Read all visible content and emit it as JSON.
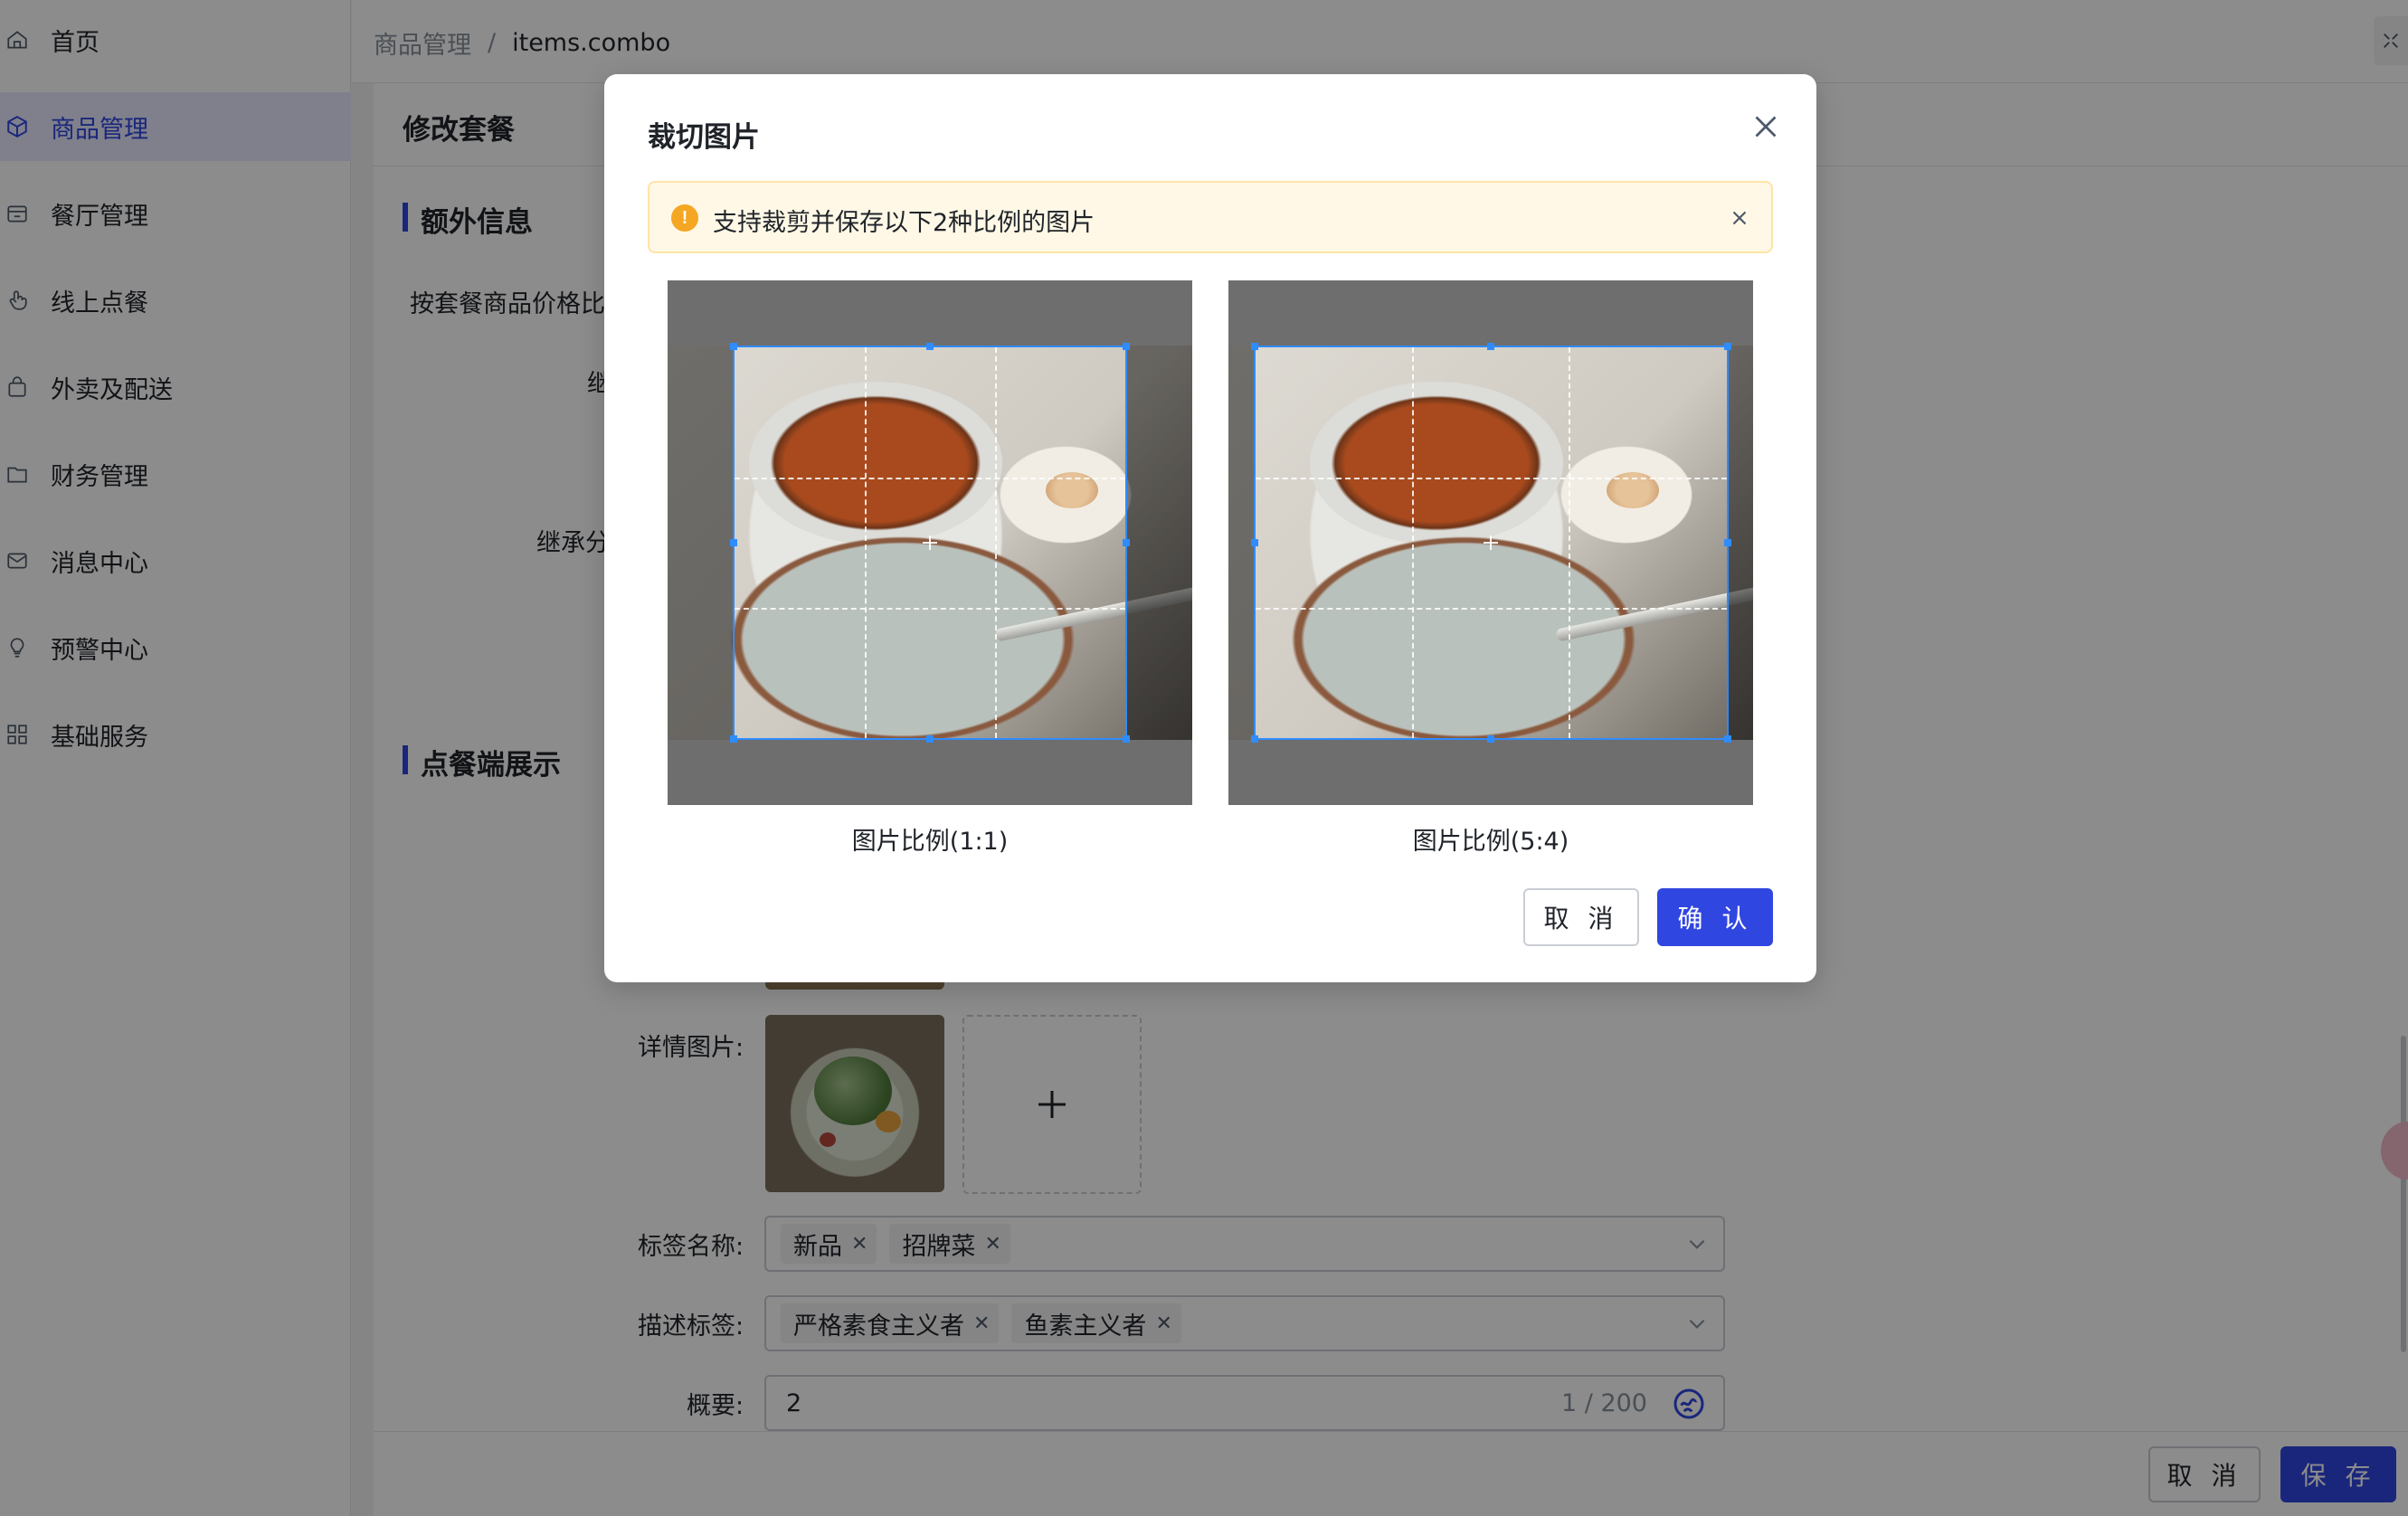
{
  "sidebar": {
    "items": [
      {
        "label": "首页",
        "icon": "home-icon"
      },
      {
        "label": "商品管理",
        "icon": "cube-icon",
        "active": true
      },
      {
        "label": "餐厅管理",
        "icon": "store-icon"
      },
      {
        "label": "线上点餐",
        "icon": "tap-icon"
      },
      {
        "label": "外卖及配送",
        "icon": "bag-icon"
      },
      {
        "label": "财务管理",
        "icon": "folder-icon"
      },
      {
        "label": "消息中心",
        "icon": "mail-icon"
      },
      {
        "label": "预警中心",
        "icon": "bulb-icon"
      },
      {
        "label": "基础服务",
        "icon": "grid-icon"
      }
    ]
  },
  "breadcrumb": {
    "parent": "商品管理",
    "separator": "/",
    "current": "items.combo"
  },
  "page": {
    "title": "修改套餐",
    "section_extra": "额外信息",
    "field_price_ratio": "按套餐商品价格比",
    "field_inherit_1": "继",
    "field_inherit_2": "继承分",
    "section_display": "点餐端展示",
    "detail_images_label": "详情图片:",
    "tags_label": "标签名称:",
    "tags": [
      "新品",
      "招牌菜"
    ],
    "desc_tags_label": "描述标签:",
    "desc_tags": [
      "严格素食主义者",
      "鱼素主义者"
    ],
    "summary_label": "概要:",
    "summary_value": "2",
    "summary_count": "1 / 200"
  },
  "footer": {
    "cancel_label": "取 消",
    "save_label": "保 存"
  },
  "modal": {
    "title": "裁切图片",
    "alert_text": "支持裁剪并保存以下2种比例的图片",
    "crop_1_caption": "图片比例(1:1)",
    "crop_2_caption": "图片比例(5:4)",
    "cancel_label": "取 消",
    "confirm_label": "确 认"
  },
  "colors": {
    "primary": "#3046e0",
    "crop_border": "#2f8cff",
    "alert_bg": "#fff8e6",
    "alert_icon": "#f5a623"
  }
}
